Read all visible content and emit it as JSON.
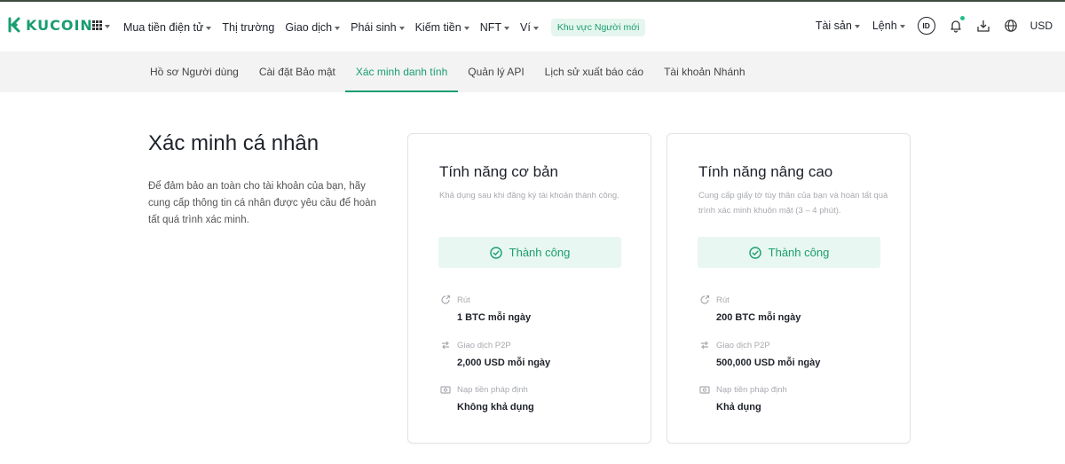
{
  "brand": {
    "name": "KUCOIN",
    "color": "#1a9e6f"
  },
  "header": {
    "nav": [
      {
        "label": "Mua tiền điện tử",
        "dropdown": true
      },
      {
        "label": "Thị trường",
        "dropdown": false
      },
      {
        "label": "Giao dịch",
        "dropdown": true
      },
      {
        "label": "Phái sinh",
        "dropdown": true
      },
      {
        "label": "Kiếm tiền",
        "dropdown": true
      },
      {
        "label": "NFT",
        "dropdown": true
      },
      {
        "label": "Ví",
        "dropdown": true
      }
    ],
    "promo": "Khu vực Người mới",
    "assets": "Tài sản",
    "orders": "Lệnh",
    "id_badge": "ID",
    "currency": "USD"
  },
  "subnav": {
    "items": [
      "Hồ sơ Người dùng",
      "Cài đặt Bảo mật",
      "Xác minh danh tính",
      "Quản lý API",
      "Lịch sử xuất báo cáo",
      "Tài khoản Nhánh"
    ],
    "active_index": 2
  },
  "intro": {
    "title": "Xác minh cá nhân",
    "description": "Để đảm bảo an toàn cho tài khoản của bạn, hãy cung cấp thông tin cá nhân được yêu cầu để hoàn tất quá trình xác minh."
  },
  "cards": [
    {
      "title": "Tính năng cơ bản",
      "subtitle": "Khả dụng sau khi đăng ký tài khoản thành công.",
      "status": "Thành công",
      "features": [
        {
          "icon": "withdraw-icon",
          "label": "Rút",
          "value": "1 BTC mỗi ngày"
        },
        {
          "icon": "p2p-icon",
          "label": "Giao dịch P2P",
          "value": "2,000 USD mỗi ngày"
        },
        {
          "icon": "fiat-deposit-icon",
          "label": "Nạp tiền pháp định",
          "value": "Không khả dụng"
        }
      ]
    },
    {
      "title": "Tính năng nâng cao",
      "subtitle": "Cung cấp giấy tờ tùy thân của bạn và hoàn tất quá trình xác minh khuôn mặt (3 – 4 phút).",
      "status": "Thành công",
      "features": [
        {
          "icon": "withdraw-icon",
          "label": "Rút",
          "value": "200 BTC mỗi ngày"
        },
        {
          "icon": "p2p-icon",
          "label": "Giao dịch P2P",
          "value": "500,000 USD mỗi ngày"
        },
        {
          "icon": "fiat-deposit-icon",
          "label": "Nạp tiền pháp định",
          "value": "Khả dụng"
        }
      ]
    }
  ]
}
